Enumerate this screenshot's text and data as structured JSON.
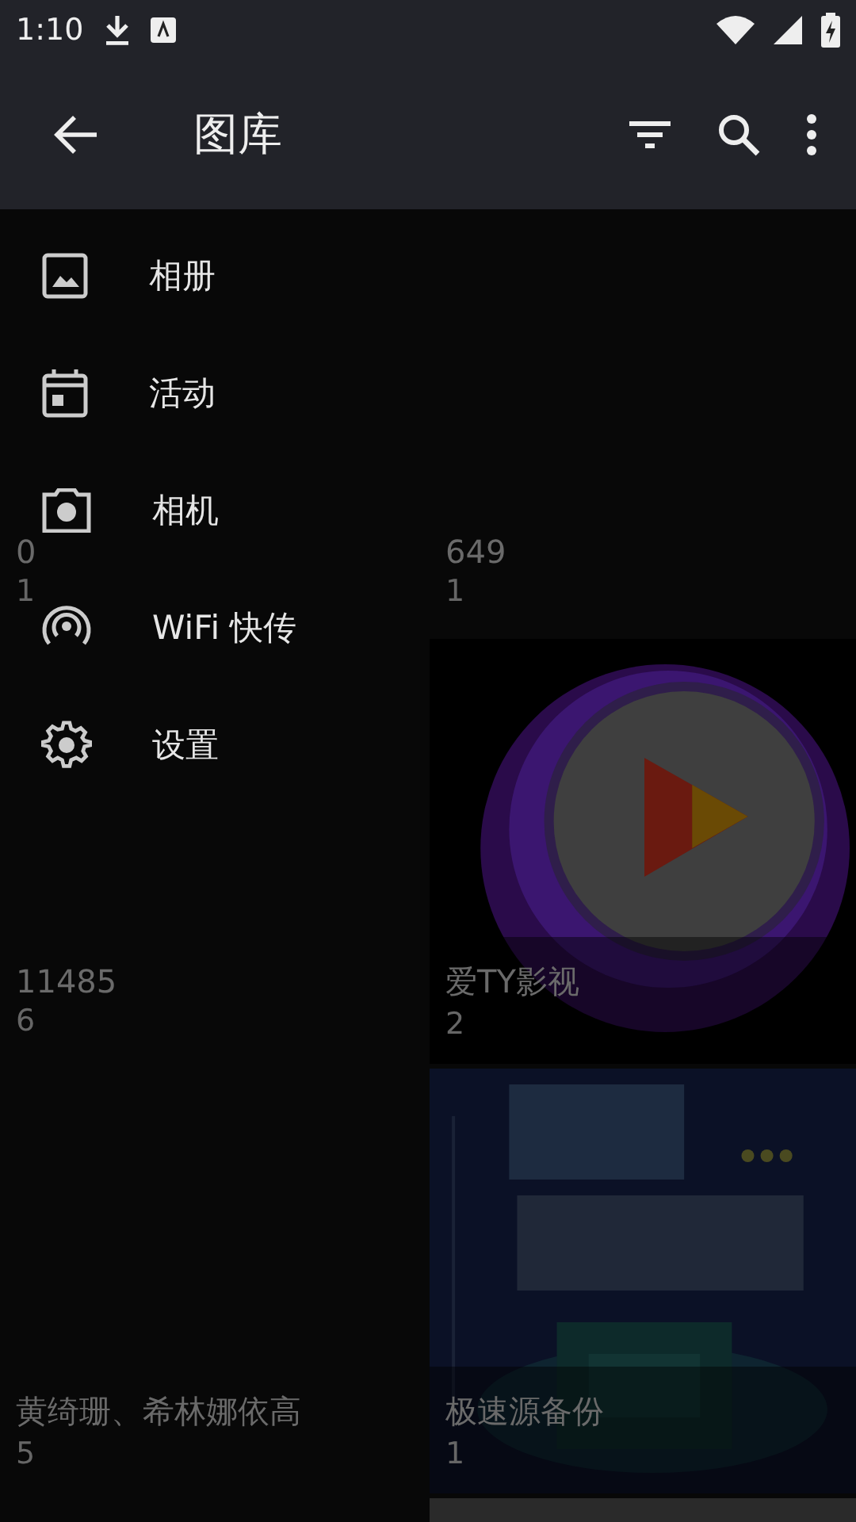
{
  "status_bar": {
    "time": "1:10"
  },
  "app_bar": {
    "title": "图库"
  },
  "albums": [
    {
      "name": "0",
      "count": "1",
      "kind": "empty"
    },
    {
      "name": "649",
      "count": "1",
      "kind": "empty"
    },
    {
      "name": "11485",
      "count": "6",
      "kind": "empty"
    },
    {
      "name": "爱TY影视",
      "count": "2",
      "kind": "picture"
    },
    {
      "name": "黄绮珊、希林娜依高",
      "count": "5",
      "kind": "empty"
    },
    {
      "name": "极速源备份",
      "count": "1",
      "kind": "picture"
    }
  ],
  "menu": [
    {
      "label": "相册"
    },
    {
      "label": "活动"
    },
    {
      "label": "相机"
    },
    {
      "label": "WiFi 快传"
    },
    {
      "label": "设置"
    }
  ]
}
